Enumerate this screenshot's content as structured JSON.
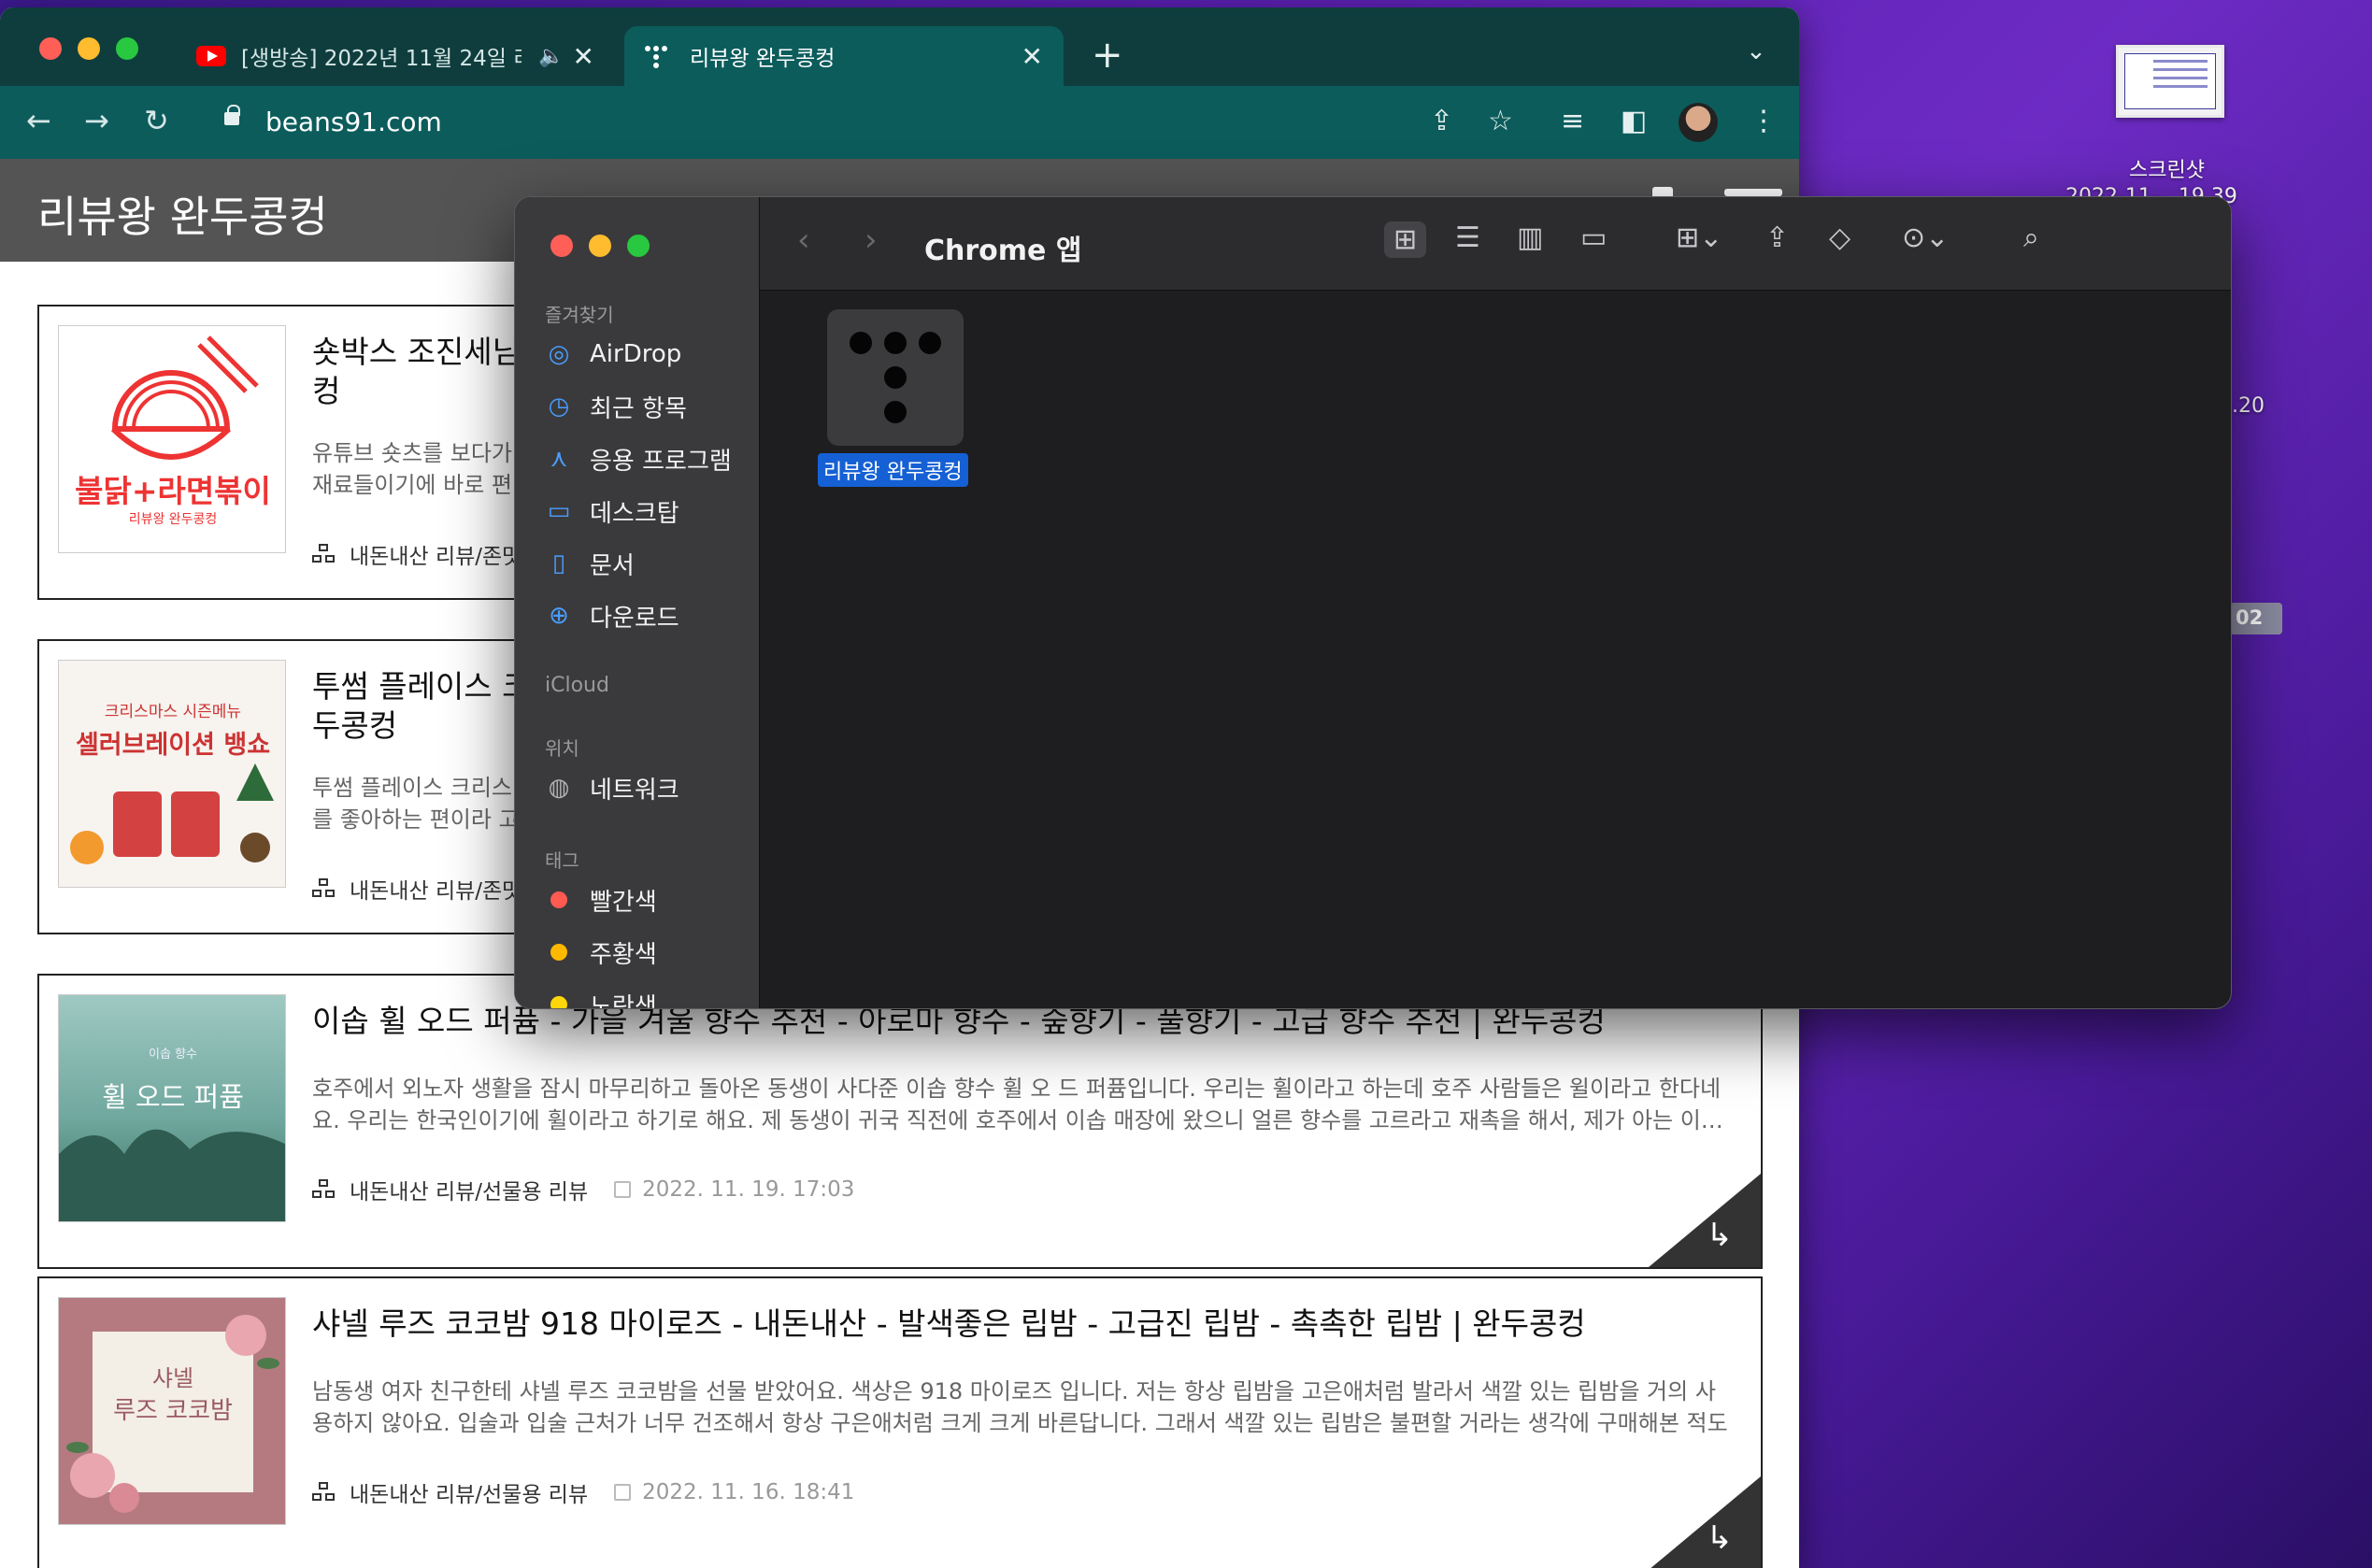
{
  "desktop": {
    "item_label": "스크린샷",
    "item_sub": "2022-11-...19.39",
    "partial_1": ".20",
    "partial_2": "02"
  },
  "chrome": {
    "tabs": [
      {
        "label": "[생방송] 2022년 11월 24일 리",
        "audio_icon": "speaker-icon",
        "close": "✕"
      },
      {
        "label": "리뷰왕 완두콩컹",
        "close": "✕"
      }
    ],
    "new_tab": "+",
    "url": "beans91.com"
  },
  "site": {
    "title": "리뷰왕 완두콩컹",
    "posts": [
      {
        "title": "숏박스 조진세님 ... 컹",
        "title_line1": "숏박스 조진세님",
        "title_line2": "컹",
        "desc_line1": "유튜브 숏츠를 보다가",
        "desc_line2": "재료들이기에 바로 편",
        "category": "내돈내산 리뷰/존맛",
        "thumb_main": "불닭+라면볶이",
        "thumb_sub": "리뷰왕 완두콩컹"
      },
      {
        "title_line1": "투썸 플레이스 크",
        "title_line2": "두콩컹",
        "desc_line1": "투썸 플레이스 크리스",
        "desc_line2": "를 좋아하는 편이라 고",
        "category": "내돈내산 리뷰/존맛",
        "thumb_top": "크리스마스 시즌메뉴",
        "thumb_main": "셀러브레이션 뱅쇼"
      },
      {
        "title": "이솝 휠 오드 퍼퓸 - 가을 겨울 향수 추천 - 아로마 향수 - 숲향기 - 풀향기 - 고급 향수 추천 | 완두콩컹",
        "desc": "호주에서 외노자 생활을 잠시 마무리하고 돌아온 동생이 사다준 이솝 향수 휠 오 드 퍼퓸입니다. 우리는 휠이라고 하는데 호주 사람들은 윌이라고 한다네요. 우리는 한국인이기에 휠이라고 하기로 해요. 제 동생이 귀국 직전에 호주에서 이솝 매장에 왔으니 얼른 향수를 고르라고 재촉을 해서, 제가 아는 이…",
        "category": "내돈내산 리뷰/선물용 리뷰",
        "date": "2022. 11. 19. 17:03",
        "thumb_top": "이솝 향수",
        "thumb_main": "휠 오드 퍼퓸",
        "corner_icon": "share-arrow-icon"
      },
      {
        "title": "샤넬 루즈 코코밤 918 마이로즈 - 내돈내산 - 발색좋은 립밤 - 고급진 립밤 - 촉촉한 립밤 | 완두콩컹",
        "desc": "남동생 여자 친구한테 샤넬 루즈 코코밤을 선물 받았어요. 색상은 918 마이로즈 입니다. 저는 항상 립밤을 고은애처럼 발라서 색깔 있는 립밤을 거의 사용하지 않아요. 입술과 입술 근처가 너무 건조해서 항상 구은애처럼 크게 크게 바른답니다. 그래서 색깔 있는 립밤은 불편할 거라는 생각에 구매해본 적도 …",
        "category": "내돈내산 리뷰/선물용 리뷰",
        "date": "2022. 11. 16. 18:41",
        "thumb_top": "샤넬",
        "thumb_main": "루즈 코코밤",
        "corner_icon": "share-arrow-icon"
      }
    ]
  },
  "finder": {
    "title": "Chrome 앱",
    "sidebar": {
      "favorites_header": "즐겨찾기",
      "favorites": [
        {
          "label": "AirDrop",
          "icon": "airdrop-icon"
        },
        {
          "label": "최근 항목",
          "icon": "clock-icon"
        },
        {
          "label": "응용 프로그램",
          "icon": "apps-icon"
        },
        {
          "label": "데스크탑",
          "icon": "desktop-icon"
        },
        {
          "label": "문서",
          "icon": "document-icon"
        },
        {
          "label": "다운로드",
          "icon": "download-icon"
        }
      ],
      "icloud_header": "iCloud",
      "locations_header": "위치",
      "locations": [
        {
          "label": "네트워크",
          "icon": "globe-icon"
        }
      ],
      "tags_header": "태그",
      "tags": [
        {
          "label": "빨간색",
          "color": "#ff5a52"
        },
        {
          "label": "주황색",
          "color": "#ffb800"
        },
        {
          "label": "노란색",
          "color": "#ffd60a"
        }
      ]
    },
    "items": [
      {
        "label": "리뷰왕 완두콩컹",
        "icon": "app-dots-icon"
      }
    ]
  },
  "colors": {
    "chrome_tabbar": "#0f3d3d",
    "chrome_toolbar": "#0c5c5c",
    "site_header": "#545454",
    "finder_bg": "#1e1e20",
    "finder_sidebar": "#3a3a3c",
    "selection": "#1560d4"
  }
}
